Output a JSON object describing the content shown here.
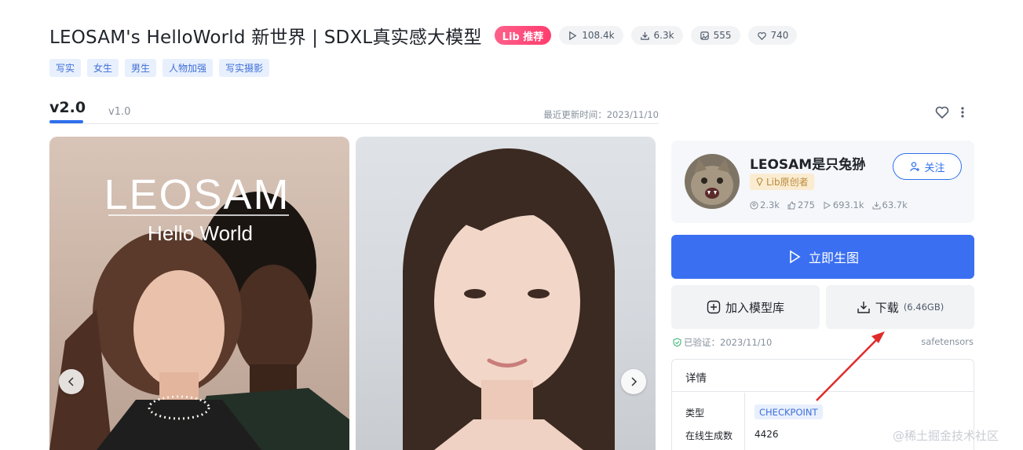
{
  "title": "LEOSAM's HelloWorld 新世界 | SDXL真实感大模型",
  "badge": "Lib 推荐",
  "stats": {
    "plays": "108.4k",
    "downloads": "6.3k",
    "images": "555",
    "likes": "740"
  },
  "tags": [
    "写实",
    "女生",
    "男生",
    "人物加强",
    "写实摄影"
  ],
  "versions": {
    "active": "v2.0",
    "other": "v1.0"
  },
  "update_time": "最近更新时间：2023/11/10",
  "image1": {
    "logo": "LEOSAM",
    "subtitle": "Hello World"
  },
  "author": {
    "name": "LEOSAM是只兔狲",
    "badge": "Lib原创者",
    "followers": "2.3k",
    "likes": "275",
    "plays": "693.1k",
    "downloads": "63.7k",
    "follow_label": "关注"
  },
  "actions": {
    "generate": "立即生图",
    "add_library": "加入模型库",
    "download": "下载",
    "download_size": "(6.46GB)"
  },
  "verified": "已验证：2023/11/10",
  "format": "safetensors",
  "details": {
    "heading": "详情",
    "type_label": "类型",
    "type_value": "CHECKPOINT",
    "gen_label": "在线生成数",
    "gen_value": "4426"
  },
  "watermark": "@稀土掘金技术社区",
  "colors": {
    "primary": "#3a6ff2",
    "badge": "#ff3d6e",
    "tag_bg": "#e8f0fd",
    "arrow": "#e02b2b"
  }
}
